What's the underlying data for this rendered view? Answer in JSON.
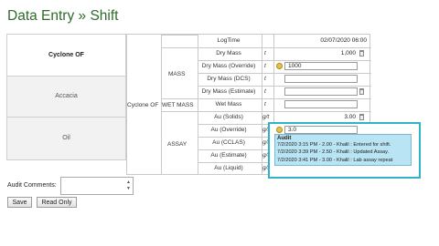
{
  "page_title": "Data Entry » Shift",
  "sites": [
    {
      "name": "Cyclone OF",
      "selected": true
    },
    {
      "name": "Accacia",
      "selected": false
    },
    {
      "name": "Oil",
      "selected": false
    }
  ],
  "site_label": "Cyclone OF",
  "groups": {
    "mass": "MASS",
    "wet_mass": "WET MASS",
    "assay": "ASSAY"
  },
  "rows": {
    "logtime": {
      "label": "LogTime",
      "value": "02/07/2020 06:00"
    },
    "dry_mass": {
      "label": "Dry Mass",
      "unit": "t",
      "value": "1,000"
    },
    "dry_mass_override": {
      "label": "Dry Mass (Override)",
      "unit": "t",
      "input": "1000"
    },
    "dry_mass_dcs": {
      "label": "Dry Mass (DCS)",
      "unit": "t",
      "input": ""
    },
    "dry_mass_estimate": {
      "label": "Dry Mass (Estimate)",
      "unit": "t",
      "input": ""
    },
    "wet_mass": {
      "label": "Wet Mass",
      "unit": "t",
      "input": ""
    },
    "au_solids": {
      "label": "Au (Solids)",
      "unit": "g/t",
      "value": "3.00"
    },
    "au_override": {
      "label": "Au (Override)",
      "unit": "g/t",
      "input": "3.0"
    },
    "au_cclas": {
      "label": "Au (CCLAS)",
      "unit": "g/t"
    },
    "au_estimate": {
      "label": "Au (Estimate)",
      "unit": "g/t"
    },
    "au_liquid": {
      "label": "Au (Liquid)",
      "unit": "g/t"
    }
  },
  "audit": {
    "heading": "Audit",
    "entries": [
      "7/2/2020 3:15 PM - 2.00 - Khalil : Entered for shift.",
      "7/2/2020 3:39 PM - 2.50 - Khalil : Updated Assay.",
      "7/2/2020 3:41 PM - 3.00 - Khalil : Lab assay repeat"
    ]
  },
  "comments": {
    "label": "Audit Comments:",
    "value": ""
  },
  "buttons": {
    "save": "Save",
    "read_only": "Read Only"
  }
}
